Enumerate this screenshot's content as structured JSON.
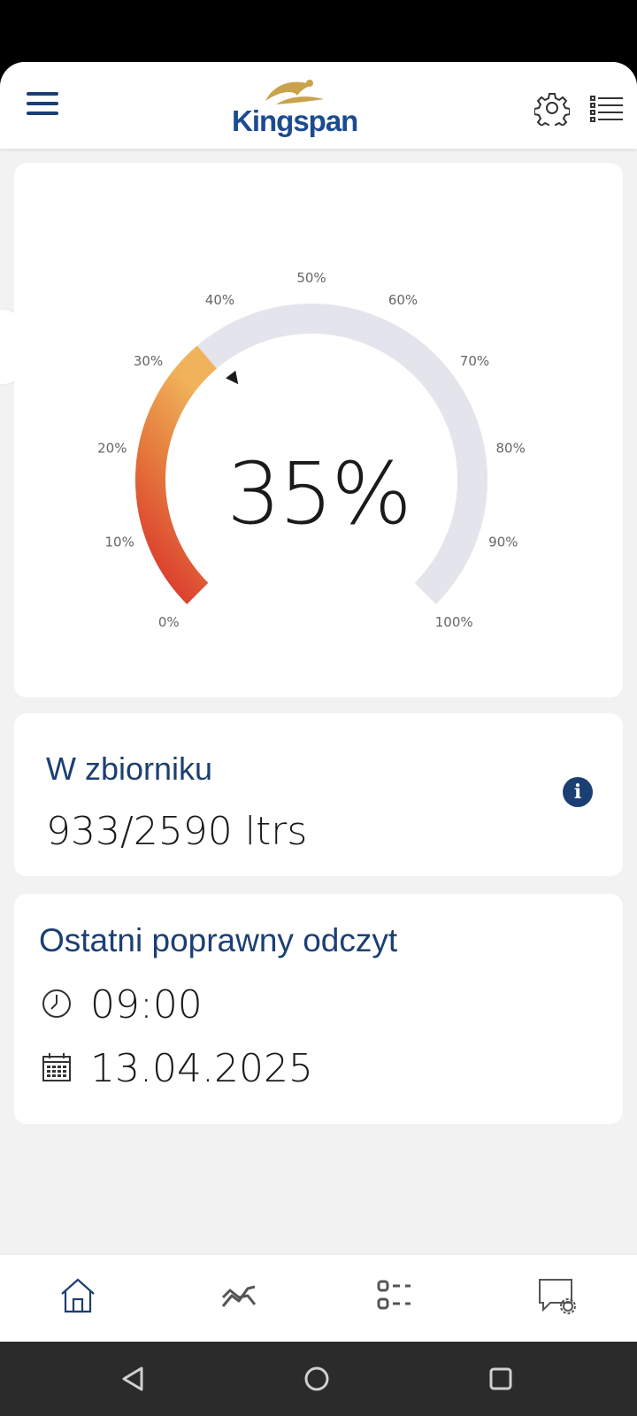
{
  "brand": {
    "name": "Kingspan",
    "color": "#1c4b8f"
  },
  "header": {
    "menu_icon": "hamburger-menu-icon",
    "settings_icon": "gear-icon",
    "list_icon": "list-icon"
  },
  "gauge": {
    "value_label": "35%",
    "level_fraction": 0.35,
    "gradient_colors": [
      "#d9302c",
      "#e57a3c",
      "#f0b25a"
    ],
    "track_color": "#e4e4ec",
    "ticks": [
      "0%",
      "10%",
      "20%",
      "30%",
      "40%",
      "50%",
      "60%",
      "70%",
      "80%",
      "90%",
      "100%"
    ]
  },
  "tank": {
    "title": "W zbiorniku",
    "value": "933/2590 ltrs",
    "info_icon": "info-icon"
  },
  "reading": {
    "title": "Ostatni poprawny odczyt",
    "time": "09:00",
    "date": "13.04.2025",
    "time_icon": "clock-icon",
    "date_icon": "calendar-icon"
  },
  "bottom_nav": [
    "home-icon",
    "trend-chart-icon",
    "checklist-icon",
    "chat-settings-icon"
  ],
  "system_nav": [
    "back-icon",
    "home-circle-icon",
    "recents-icon"
  ]
}
